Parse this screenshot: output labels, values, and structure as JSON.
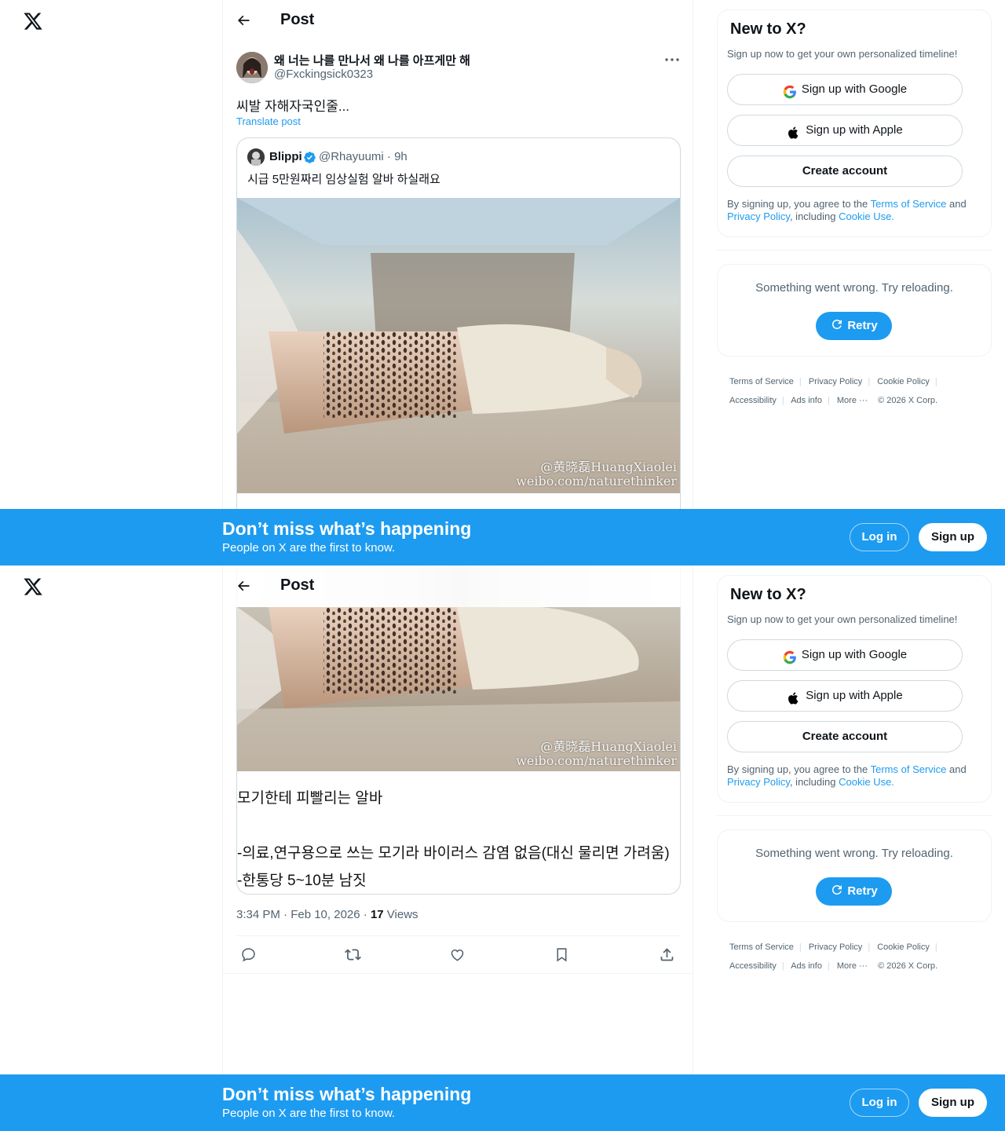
{
  "colors": {
    "accent": "#1d9bf0",
    "text": "#0f1419",
    "muted": "#536471",
    "border": "#cfd9de"
  },
  "nav": {
    "logo": "x-logo-icon"
  },
  "header": {
    "title": "Post",
    "back_icon": "arrow-left-icon"
  },
  "tweet": {
    "display_name": "왜 너는 나를 만나서 왜 나를 아프게만 해",
    "handle": "@Fxckingsick0323",
    "text": "씨발 자해자국인줄...",
    "translate": "Translate post",
    "time": "3:34 PM · Feb 10, 2026 · ",
    "views_count": "17",
    "views_label": " Views"
  },
  "quote": {
    "name": "Blippi",
    "handle_time": "@Rhayuumi · 9h",
    "text": "시급 5만원짜리 임상실험 알바 하실래요",
    "image_watermark_1": "@黄晓磊HuangXiaolei",
    "image_watermark_2": "weibo.com/naturethinker",
    "lines": [
      "모기한테 피빨리는 알바",
      "-의료,연구용으로 쓰는 모기라 바이러스 감염 없음(대신 물리면 가려움)",
      "-한통당 5~10분 남짓"
    ]
  },
  "actions": [
    "reply-icon",
    "repost-icon",
    "like-icon",
    "bookmark-icon",
    "share-icon"
  ],
  "signup": {
    "title": "New to X?",
    "subtitle": "Sign up now to get your own personalized timeline!",
    "google": "Sign up with Google",
    "apple": "Sign up with Apple",
    "create": "Create account",
    "legal_prefix": "By signing up, you agree to the ",
    "terms": "Terms of Service",
    "and": " and ",
    "privacy": "Privacy Policy",
    "including": ", including ",
    "cookie": "Cookie Use."
  },
  "error": {
    "message": "Something went wrong. Try reloading.",
    "retry": "Retry"
  },
  "footer": {
    "terms": "Terms of Service",
    "privacy": "Privacy Policy",
    "cookie": "Cookie Policy",
    "accessibility": "Accessibility",
    "ads": "Ads info",
    "more": "More ···",
    "copyright": "© 2026 X Corp."
  },
  "banner": {
    "title": "Don’t miss what’s happening",
    "subtitle": "People on X are the first to know.",
    "login": "Log in",
    "signup": "Sign up"
  }
}
